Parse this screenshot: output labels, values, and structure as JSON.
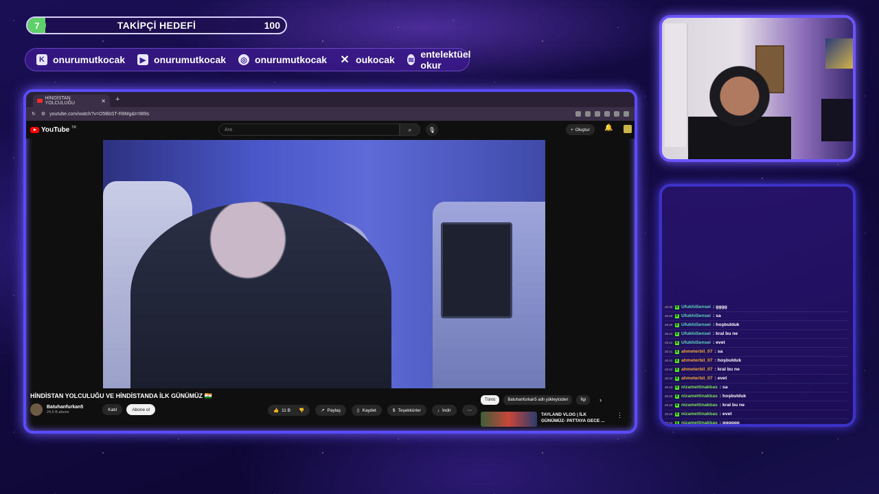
{
  "follower_goal": {
    "current": "7",
    "title": "TAKİPÇİ HEDEFİ",
    "target": "100",
    "progress_fraction": 0.07,
    "color": "#5fd06a"
  },
  "socials": [
    {
      "icon": "kick-icon",
      "glyph": "K",
      "handle": "onurumutkocak"
    },
    {
      "icon": "youtube-icon",
      "glyph": "▶",
      "handle": "onurumutkocak"
    },
    {
      "icon": "instagram-icon",
      "glyph": "◎",
      "handle": "onurumutkocak"
    },
    {
      "icon": "x-icon",
      "glyph": "✕",
      "handle": "oukocak"
    },
    {
      "icon": "spotify-icon",
      "glyph": "≋",
      "handle": "entelektüel okur"
    }
  ],
  "browser": {
    "tab_title": "HİNDİSTAN YOLCULUĞU",
    "url": "youtube.com/watch?v=O5BbST-R8Mg&t=989s"
  },
  "youtube": {
    "logo": "YouTube",
    "region": "TR",
    "search_placeholder": "Ara",
    "create_label": "Oluştur",
    "video_title": "HİNDİSTAN YOLCULUĞU VE HİNDİSTANDA İLK GÜNÜMÜZ 🇮🇳",
    "channel_name": "Batuhanfurkan5",
    "subscribers": "24,5 B abone",
    "join_label": "Katıl",
    "subscribe_label": "Abone ol",
    "likes": "11 B",
    "share_label": "Paylaş",
    "save_label": "Kaydet",
    "thanks_label": "Teşekkürler",
    "download_label": "İndir",
    "chips": [
      "Tümü",
      "Batuhanfurkan5 adlı yükleyiciden",
      "İlgi"
    ],
    "rec_title": "TAYLAND VLOG | İLK GÜNÜMÜZ- PATTAYA GECE ..."
  },
  "chat": {
    "messages": [
      {
        "time": "20:40",
        "user": "UfukhiSensei",
        "color": "#5fd8c0",
        "text": "gggg"
      },
      {
        "time": "20:40",
        "user": "UfukhiSensei",
        "color": "#5fd8c0",
        "text": "sa"
      },
      {
        "time": "20:40",
        "user": "UfukhiSensei",
        "color": "#5fd8c0",
        "text": "hoşbulduk"
      },
      {
        "time": "20:41",
        "user": "UfukhiSensei",
        "color": "#5fd8c0",
        "text": "kral bu ne"
      },
      {
        "time": "20:41",
        "user": "UfukhiSensei",
        "color": "#5fd8c0",
        "text": "evet"
      },
      {
        "time": "20:41",
        "user": "ahmeterbil_07",
        "color": "#f0a93a",
        "text": "sa"
      },
      {
        "time": "20:41",
        "user": "ahmeterbil_07",
        "color": "#f0a93a",
        "text": "hoşbulduk"
      },
      {
        "time": "20:42",
        "user": "ahmeterbil_07",
        "color": "#f0a93a",
        "text": "kral bu ne"
      },
      {
        "time": "20:42",
        "user": "ahmeterbil_07",
        "color": "#f0a93a",
        "text": "evet"
      },
      {
        "time": "20:43",
        "user": "nizamettinakbas",
        "color": "#7ee05a",
        "text": "sa"
      },
      {
        "time": "20:43",
        "user": "nizamettinakbas",
        "color": "#7ee05a",
        "text": "hoşbulduk"
      },
      {
        "time": "20:43",
        "user": "nizamettinakbas",
        "color": "#7ee05a",
        "text": "kral bu ne"
      },
      {
        "time": "20:43",
        "user": "nizamettinakbas",
        "color": "#7ee05a",
        "text": "evet"
      },
      {
        "time": "20:44",
        "user": "nizamettinakbas",
        "color": "#7ee05a",
        "text": "gggggg"
      }
    ]
  }
}
